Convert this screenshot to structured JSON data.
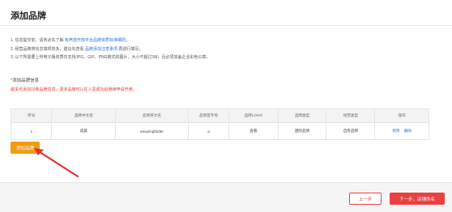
{
  "header": {
    "title": "添加品牌"
  },
  "notes": [
    {
      "prefix": "1. 信息提交前，请务必先了解 ",
      "link": "请务必先了解有声挂开放平台品牌资质标准细则",
      "link_text": "有声挂开放平台品牌资质标准细则",
      "suffix": "；"
    },
    {
      "prefix": "2. 经营品牌类信息填项较多，建议先查看 ",
      "link_text": "品牌添加注意事项",
      "suffix": " 再进行填写；"
    },
    {
      "prefix": "3. 以下所需要上传电子版资质仅支持JPG、GIF、PNG格式的图片，大小不超过1M，且必须加盖企业彩色公章。",
      "link_text": "",
      "suffix": ""
    }
  ],
  "section": {
    "star": "*",
    "title": "添加品牌信息",
    "tip": "最多可添加10条品牌信息，更多品牌可以在入驻成功后继续申请开通。"
  },
  "table": {
    "headers": [
      "序号",
      "品牌中文名",
      "品牌英文名",
      "品牌首字母",
      "品牌LOGO",
      "品牌类型",
      "经营类型",
      "操作"
    ],
    "rows": [
      {
        "index": "1",
        "cn_name": "成晨",
        "en_name": "amazingfolder",
        "initial": "a",
        "logo": "查看",
        "brand_type": "国际品牌",
        "biz_type": "自有品牌",
        "edit": "修改",
        "delete": "删除"
      }
    ]
  },
  "actions": {
    "add_brand": "添加品牌",
    "prev": "上一步",
    "next": "下一步，店铺命名"
  },
  "colors": {
    "accent_orange": "#f39a14",
    "accent_red": "#e94040",
    "link_blue": "#2a6fd6"
  }
}
